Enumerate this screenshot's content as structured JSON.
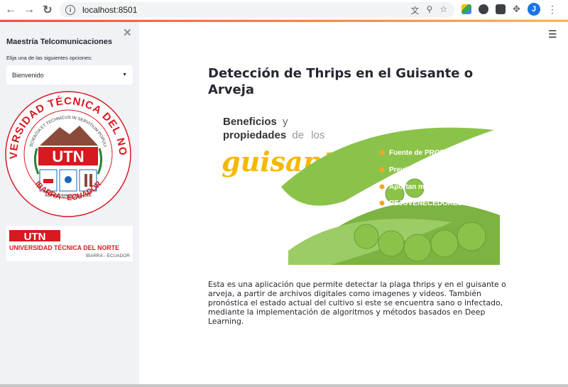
{
  "browser": {
    "url": "localhost:8501",
    "avatar_letter": "J"
  },
  "sidebar": {
    "title": "Maestría Telcomunicaciones",
    "select_label": "Elija una de las siguientes opciones:",
    "select_value": "Bienvenido",
    "seal": {
      "top_arc": "UNIVERSIDAD TÉCNICA DEL NORTE",
      "inner_arc": "SCIENTIA ET TECHNICUS IN SERVITIUM POPULI",
      "acronym": "UTN",
      "autonomy": "AUTONOMA DESDE 1986",
      "city": "IBARRA - ECUADOR"
    },
    "banner": {
      "acronym": "UTN",
      "name": "UNIVERSIDAD TÉCNICA DEL NORTE",
      "city": "IBARRA - ECUADOR"
    }
  },
  "main": {
    "title": "Detección de Thrips en el Guisante o Arveja",
    "hero": {
      "heading_1": "Beneficios",
      "heading_2": "y",
      "heading_3": "propiedades",
      "heading_4": "de",
      "heading_5": "los",
      "script_word": "guisantes",
      "bullets": [
        "Fuente de PROTEÍNAS",
        "Previene anemia",
        "Aportan muchísima FIBRA",
        "REJUVENECEDORES"
      ]
    },
    "description": "Esta es una aplicación que permite detectar la plaga thrips y en el guisante o arveja, a partir de archivos digitales como imagenes y videos. También pronóstica el estado actual del cultivo si este se encuentra sano o infectado, mediante la implementación de algoritmos y métodos basados en Deep Learning."
  },
  "colors": {
    "accent_red": "#ff4b4b",
    "sidebar_bg": "#f0f2f6",
    "utn_red": "#d71920",
    "pea_green": "#7cb342",
    "bullet_orange": "#f5a623"
  }
}
